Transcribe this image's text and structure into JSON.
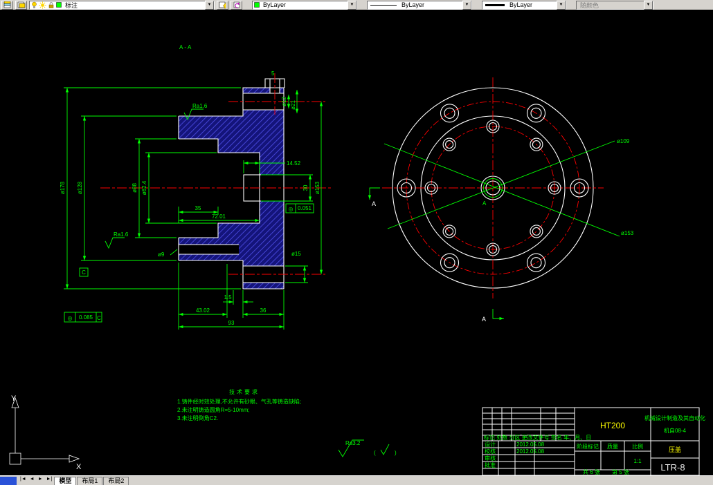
{
  "icons": {
    "dropdown": "▼"
  },
  "toolbar": {
    "layer_value": "标注",
    "color_value": "ByLayer",
    "linetype_value": "ByLayer",
    "lineweight_value": "ByLayer",
    "plotstyle_value": "随颜色"
  },
  "drawing": {
    "section_label": "A-A",
    "dims": {
      "d178": "ø178",
      "d128": "ø128",
      "d88": "ø88",
      "d62": "ø62.4",
      "d153": "ø153",
      "d30": "30",
      "d14": "14.52",
      "d35": "35",
      "d72": "72.01",
      "d9": "ø9",
      "d15": "ø15",
      "d1_5": "1.5",
      "d43": "43.02",
      "d36": "36",
      "d93": "93",
      "d5": "5",
      "d12": "ø12",
      "d21": "ø21",
      "ra": "Ra1.6",
      "d109": "ø109"
    },
    "runout_frame": {
      "symbol": "◎",
      "value": "0.051"
    },
    "position_frame": {
      "symbol": "◎",
      "value": "0.085",
      "datum": "C"
    },
    "datum_label": "C",
    "datum_a": "A",
    "section_mark": "A",
    "tech_req": {
      "title": "技术要求",
      "line1": "1.铸件经时效处理,不允许有砂眼、气孔等铸造缺陷;",
      "line2": "2.未注明铸造圆角R=5-10mm;",
      "line3": "3.未注明倒角C2."
    },
    "surface_note": {
      "ra": "Ra3.2",
      "paren_open": "(",
      "paren_close": ")"
    }
  },
  "titleblock": {
    "material": "HT200",
    "org_line1": "机械设计制造及其自动化",
    "org_line2": "机自08-4",
    "part_name": "压盖",
    "drawing_no": "LTR-8",
    "scale_value": "1:1",
    "header_row": "标记 处数 分区 更改文件号 签名 年、月、日",
    "stage_label": "阶段标记",
    "mass_label": "质量",
    "scale_label": "比例",
    "sheet_total": "共 6 张",
    "sheet_no": "第 5 张",
    "rows": [
      {
        "label": "设计",
        "date": "2012.05.08"
      },
      {
        "label": "校核",
        "date": "2012.05.08"
      },
      {
        "label": "审核",
        "date": ""
      },
      {
        "label": "批准",
        "date": ""
      }
    ]
  },
  "statusbar": {
    "nav": [
      "|◄",
      "◄",
      "►",
      "►|"
    ],
    "tabs": [
      "模型",
      "布局1",
      "布局2"
    ]
  },
  "ucs": {
    "x": "X",
    "y": "Y"
  }
}
